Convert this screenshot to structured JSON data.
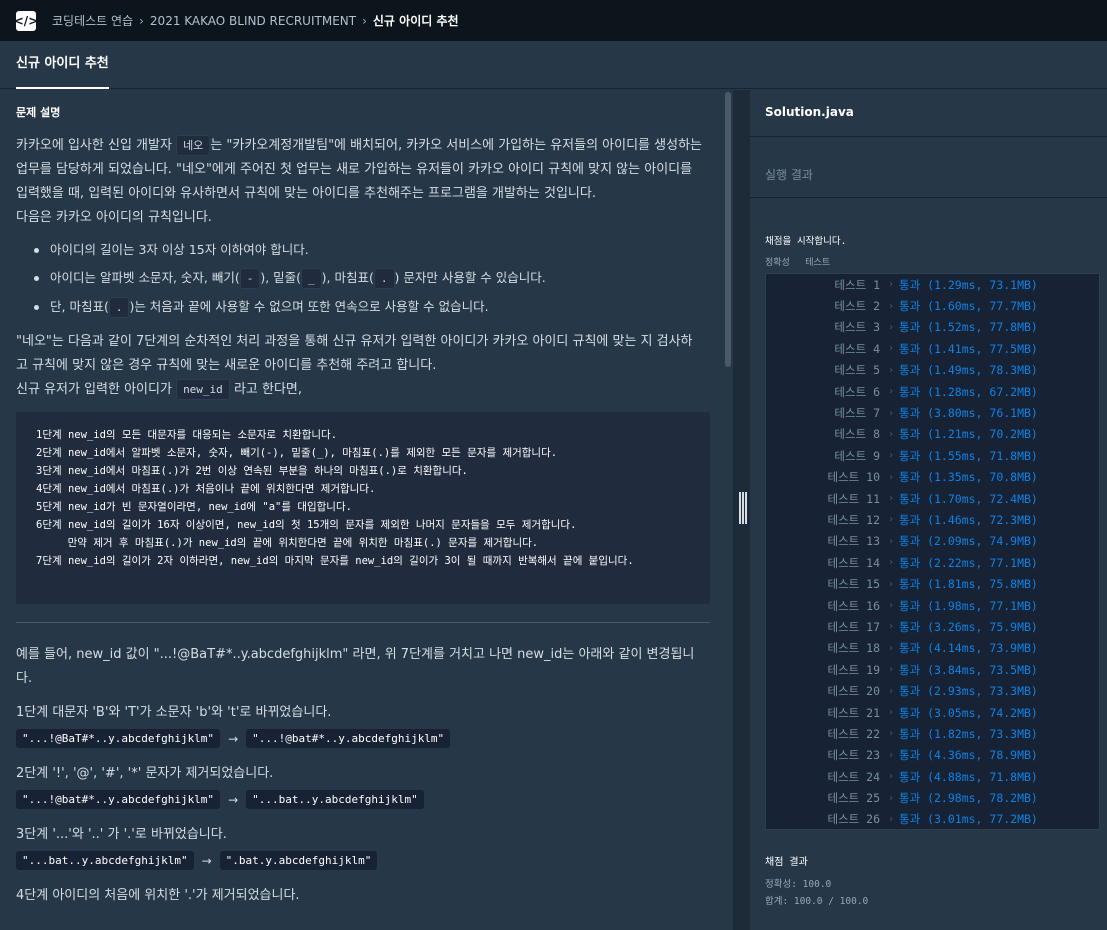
{
  "breadcrumb": [
    "코딩테스트 연습",
    "2021 KAKAO BLIND RECRUITMENT",
    "신규 아이디 추천"
  ],
  "tab_title": "신규 아이디 추천",
  "problem": {
    "section_title": "문제 설명",
    "intro_a": "카카오에 입사한 신입 개발자 ",
    "intro_code": "네오",
    "intro_b": "는 \"카카오계정개발팀\"에 배치되어, 카카오 서비스에 가입하는 유저들의 아이디를 생성하는 업무를 담당하게 되었습니다. \"네오\"에게 주어진 첫 업무는 새로 가입하는 유저들이 카카오 아이디 규칙에 맞지 않는 아이디를 입력했을 때, 입력된 아이디와 유사하면서 규칙에 맞는 아이디를 추천해주는 프로그램을 개발하는 것입니다.",
    "intro_c": "다음은 카카오 아이디의 규칙입니다.",
    "rule1": "아이디의 길이는 3자 이상 15자 이하여야 합니다.",
    "rule2_a": "아이디는 알파벳 소문자, 숫자, 빼기(",
    "rule2_code1": "-",
    "rule2_b": "), 밑줄(",
    "rule2_code2": "_",
    "rule2_c": "), 마침표(",
    "rule2_code3": ".",
    "rule2_d": ") 문자만 사용할 수 있습니다.",
    "rule3_a": "단, 마침표(",
    "rule3_code": ".",
    "rule3_b": ")는 처음과 끝에 사용할 수 없으며 또한 연속으로 사용할 수 없습니다.",
    "process_a": "\"네오\"는 다음과 같이 7단계의 순차적인 처리 과정을 통해 신규 유저가 입력한 아이디가 카카오 아이디 규칙에 맞는 지 검사하고 규칙에 맞지 않은 경우 규칙에 맞는 새로운 아이디를 추천해 주려고 합니다.",
    "process_b": "신규 유저가 입력한 아이디가 ",
    "process_code": "new_id",
    "process_c": " 라고 한다면,",
    "steps": "1단계 new_id의 모든 대문자를 대응되는 소문자로 치환합니다.\n2단계 new_id에서 알파벳 소문자, 숫자, 빼기(-), 밑줄(_), 마침표(.)를 제외한 모든 문자를 제거합니다.\n3단계 new_id에서 마침표(.)가 2번 이상 연속된 부분을 하나의 마침표(.)로 치환합니다.\n4단계 new_id에서 마침표(.)가 처음이나 끝에 위치한다면 제거합니다.\n5단계 new_id가 빈 문자열이라면, new_id에 \"a\"를 대입합니다.\n6단계 new_id의 길이가 16자 이상이면, new_id의 첫 15개의 문자를 제외한 나머지 문자들을 모두 제거합니다.\n     만약 제거 후 마침표(.)가 new_id의 끝에 위치한다면 끝에 위치한 마침표(.) 문자를 제거합니다.\n7단계 new_id의 길이가 2자 이하라면, new_id의 마지막 문자를 new_id의 길이가 3이 될 때까지 반복해서 끝에 붙입니다.",
    "example_intro": "예를 들어, new_id 값이 \"...!@BaT#*..y.abcdefghijklm\" 라면, 위 7단계를 거치고 나면 new_id는 아래와 같이 변경됩니다.",
    "ex1_text": "1단계 대문자 'B'와 'T'가 소문자 'b'와 't'로 바뀌었습니다.",
    "ex1_from": "\"...!@BaT#*..y.abcdefghijklm\"",
    "ex1_to": "\"...!@bat#*..y.abcdefghijklm\"",
    "ex2_text": "2단계 '!', '@', '#', '*' 문자가 제거되었습니다.",
    "ex2_from": "\"...!@bat#*..y.abcdefghijklm\"",
    "ex2_to": "\"...bat..y.abcdefghijklm\"",
    "ex3_text": "3단계 '...'와 '..' 가 '.'로 바뀌었습니다.",
    "ex3_from": "\"...bat..y.abcdefghijklm\"",
    "ex3_to": "\".bat.y.abcdefghijklm\"",
    "ex4_text": "4단계 아이디의 처음에 위치한 '.'가 제거되었습니다.",
    "arrow": "→"
  },
  "editor": {
    "file_name": "Solution.java",
    "result_label": "실행 결과",
    "start_message": "채점을 시작합니다.",
    "sub_tab_accuracy": "정확성",
    "sub_tab_test": "테스트",
    "tests": [
      {
        "label": "테스트 1",
        "result": "통과 (1.29ms, 73.1MB)"
      },
      {
        "label": "테스트 2",
        "result": "통과 (1.60ms, 77.7MB)"
      },
      {
        "label": "테스트 3",
        "result": "통과 (1.52ms, 77.8MB)"
      },
      {
        "label": "테스트 4",
        "result": "통과 (1.41ms, 77.5MB)"
      },
      {
        "label": "테스트 5",
        "result": "통과 (1.49ms, 78.3MB)"
      },
      {
        "label": "테스트 6",
        "result": "통과 (1.28ms, 67.2MB)"
      },
      {
        "label": "테스트 7",
        "result": "통과 (3.80ms, 76.1MB)"
      },
      {
        "label": "테스트 8",
        "result": "통과 (1.21ms, 70.2MB)"
      },
      {
        "label": "테스트 9",
        "result": "통과 (1.55ms, 71.8MB)"
      },
      {
        "label": "테스트 10",
        "result": "통과 (1.35ms, 70.8MB)"
      },
      {
        "label": "테스트 11",
        "result": "통과 (1.70ms, 72.4MB)"
      },
      {
        "label": "테스트 12",
        "result": "통과 (1.46ms, 72.3MB)"
      },
      {
        "label": "테스트 13",
        "result": "통과 (2.09ms, 74.9MB)"
      },
      {
        "label": "테스트 14",
        "result": "통과 (2.22ms, 77.1MB)"
      },
      {
        "label": "테스트 15",
        "result": "통과 (1.81ms, 75.8MB)"
      },
      {
        "label": "테스트 16",
        "result": "통과 (1.98ms, 77.1MB)"
      },
      {
        "label": "테스트 17",
        "result": "통과 (3.26ms, 75.9MB)"
      },
      {
        "label": "테스트 18",
        "result": "통과 (4.14ms, 73.9MB)"
      },
      {
        "label": "테스트 19",
        "result": "통과 (3.84ms, 73.5MB)"
      },
      {
        "label": "테스트 20",
        "result": "통과 (2.93ms, 73.3MB)"
      },
      {
        "label": "테스트 21",
        "result": "통과 (3.05ms, 74.2MB)"
      },
      {
        "label": "테스트 22",
        "result": "통과 (1.82ms, 73.3MB)"
      },
      {
        "label": "테스트 23",
        "result": "통과 (4.36ms, 78.9MB)"
      },
      {
        "label": "테스트 24",
        "result": "통과 (4.88ms, 71.8MB)"
      },
      {
        "label": "테스트 25",
        "result": "통과 (2.98ms, 78.2MB)"
      },
      {
        "label": "테스트 26",
        "result": "통과 (3.01ms, 77.2MB)"
      }
    ],
    "grade_title": "채점 결과",
    "accuracy": "정확성: 100.0",
    "total": "합계: 100.0 / 100.0"
  },
  "colors": {
    "pass": "#0f82e6",
    "background": "#263747",
    "header": "#0c151c"
  }
}
